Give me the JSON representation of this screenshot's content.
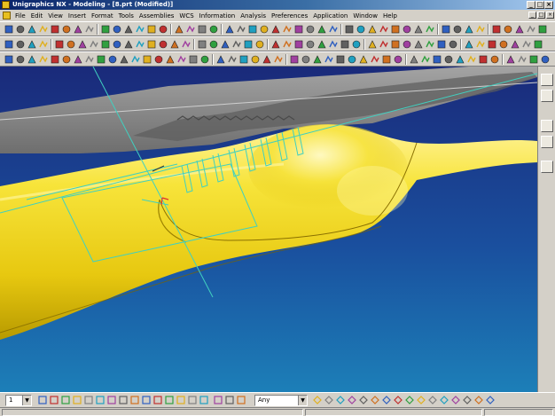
{
  "window": {
    "title": "Unigraphics NX - Modeling - [8.prt (Modified)]",
    "controls": [
      "_",
      "□",
      "×"
    ]
  },
  "menu": {
    "items": [
      "File",
      "Edit",
      "View",
      "Insert",
      "Format",
      "Tools",
      "Assemblies",
      "WCS",
      "Information",
      "Analysis",
      "Preferences",
      "Application",
      "Window",
      "Help"
    ],
    "mdi_controls": [
      "_",
      "□",
      "×"
    ]
  },
  "statusbar": {
    "layer_value": "1",
    "filter_value": "Any"
  },
  "colors": {
    "title_start": "#0a246a",
    "title_end": "#a6caf0",
    "viewport_top": "#1a2a7a",
    "viewport_bottom": "#1c7fb8",
    "part_yellow": "#f2dc1a",
    "wire_cyan": "#40d0c0"
  }
}
